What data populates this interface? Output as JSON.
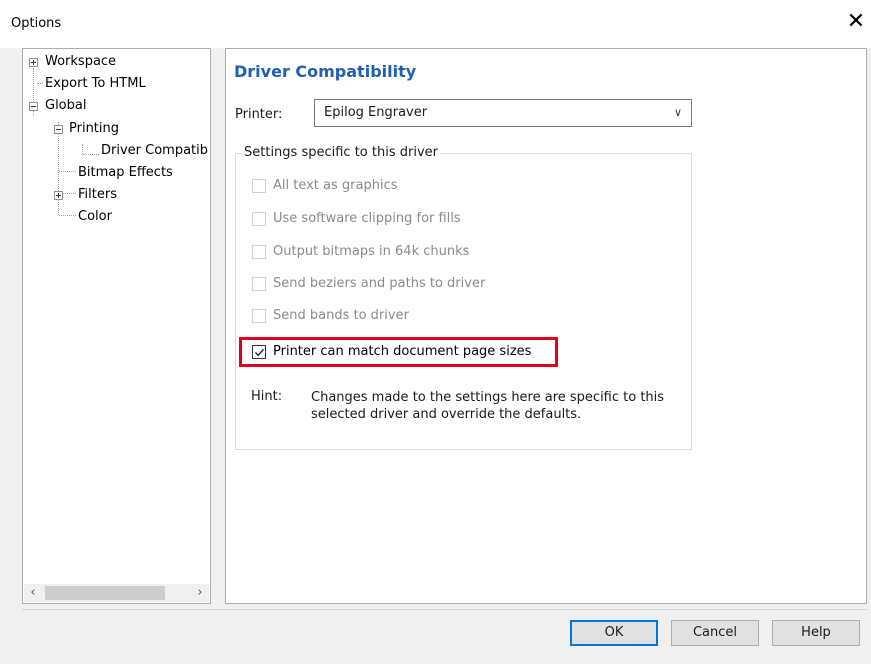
{
  "window": {
    "title": "Options"
  },
  "tree": {
    "items": [
      {
        "label": "Workspace"
      },
      {
        "label": "Export To HTML"
      },
      {
        "label": "Global"
      },
      {
        "label": "Printing"
      },
      {
        "label": "Driver Compatib"
      },
      {
        "label": "Bitmap Effects"
      },
      {
        "label": "Filters"
      },
      {
        "label": "Color"
      }
    ],
    "selected": "Driver Compatib"
  },
  "main": {
    "section_title": "Driver Compatibility",
    "printer_label": "Printer:",
    "printer_value": "Epilog Engraver",
    "group_title": "Settings specific to this driver",
    "options": [
      {
        "label": "All text as graphics",
        "checked": false,
        "enabled": false
      },
      {
        "label": "Use software clipping for fills",
        "checked": false,
        "enabled": false
      },
      {
        "label": "Output bitmaps in 64k chunks",
        "checked": false,
        "enabled": false
      },
      {
        "label": "Send beziers and paths to driver",
        "checked": false,
        "enabled": false
      },
      {
        "label": "Send bands to driver",
        "checked": false,
        "enabled": false
      },
      {
        "label": "Printer can match document page sizes",
        "checked": true,
        "enabled": true
      }
    ],
    "hint_label": "Hint:",
    "hint_text": "Changes made to the settings here are specific to this selected driver and override the defaults."
  },
  "footer": {
    "ok_label": "OK",
    "cancel_label": "Cancel",
    "help_label": "Help"
  },
  "colors": {
    "accent": "#1f5fb2",
    "highlight_box": "#e3001b",
    "default_button_border": "#0078d7"
  }
}
